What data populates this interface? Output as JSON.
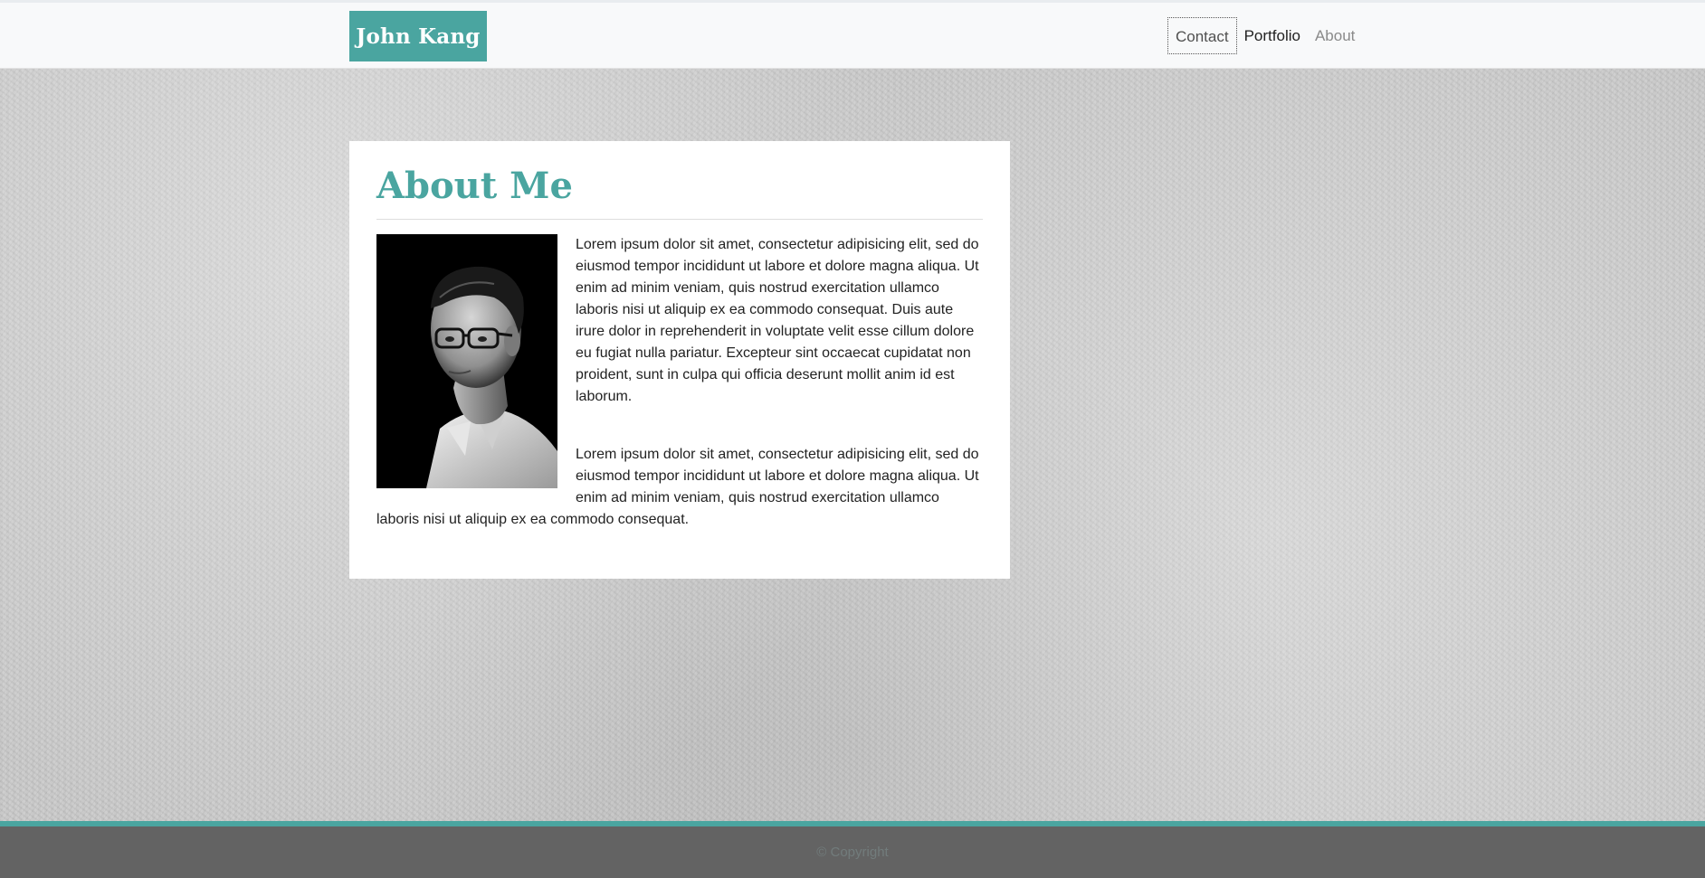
{
  "navbar": {
    "brand": "John Kang",
    "links": [
      {
        "label": "Contact"
      },
      {
        "label": "Portfolio"
      },
      {
        "label": "About"
      }
    ]
  },
  "about": {
    "title": "About Me",
    "paragraphs": [
      "Lorem ipsum dolor sit amet, consectetur adipisicing elit, sed do eiusmod tempor incididunt ut labore et dolore magna aliqua. Ut enim ad minim veniam, quis nostrud exercitation ullamco laboris nisi ut aliquip ex ea commodo consequat. Duis aute irure dolor in reprehenderit in voluptate velit esse cillum dolore eu fugiat nulla pariatur. Excepteur sint occaecat cupidatat non proident, sunt in culpa qui officia deserunt mollit anim id est laborum.",
      "Lorem ipsum dolor sit amet, consectetur adipisicing elit, sed do eiusmod tempor incididunt ut labore et dolore magna aliqua. Ut enim ad minim veniam, quis nostrud exercitation ullamco laboris nisi ut aliquip ex ea commodo consequat."
    ]
  },
  "footer": {
    "text": "© Copyright"
  },
  "colors": {
    "accent": "#4aa5a0",
    "footer_bg": "#636363",
    "navbar_bg": "#f8f9fa"
  }
}
